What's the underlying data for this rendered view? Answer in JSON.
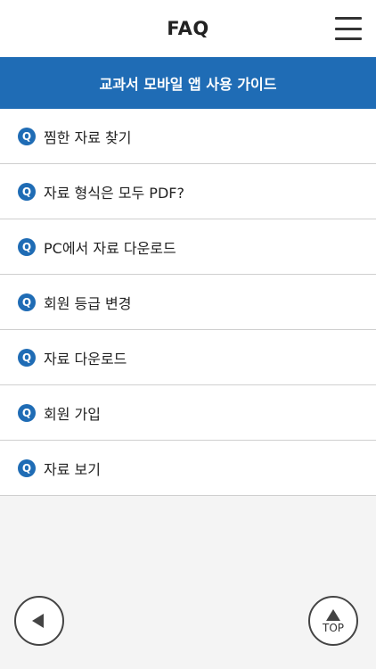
{
  "header": {
    "title": "FAQ",
    "menu_icon": "hamburger-menu-icon"
  },
  "banner": {
    "label": "교과서 모바일 앱 사용 가이드"
  },
  "faq": {
    "badge": "Q",
    "items": [
      {
        "label": "찜한 자료 찾기"
      },
      {
        "label": "자료 형식은 모두 PDF?"
      },
      {
        "label": "PC에서 자료 다운로드"
      },
      {
        "label": "회원 등급 변경"
      },
      {
        "label": "자료 다운로드"
      },
      {
        "label": "회원 가입"
      },
      {
        "label": "자료 보기"
      }
    ]
  },
  "footer": {
    "back_icon": "left-arrow-icon",
    "top_label": "TOP",
    "top_icon": "up-arrow-icon"
  },
  "colors": {
    "accent": "#1f6cb5",
    "background": "#f4f4f4"
  }
}
